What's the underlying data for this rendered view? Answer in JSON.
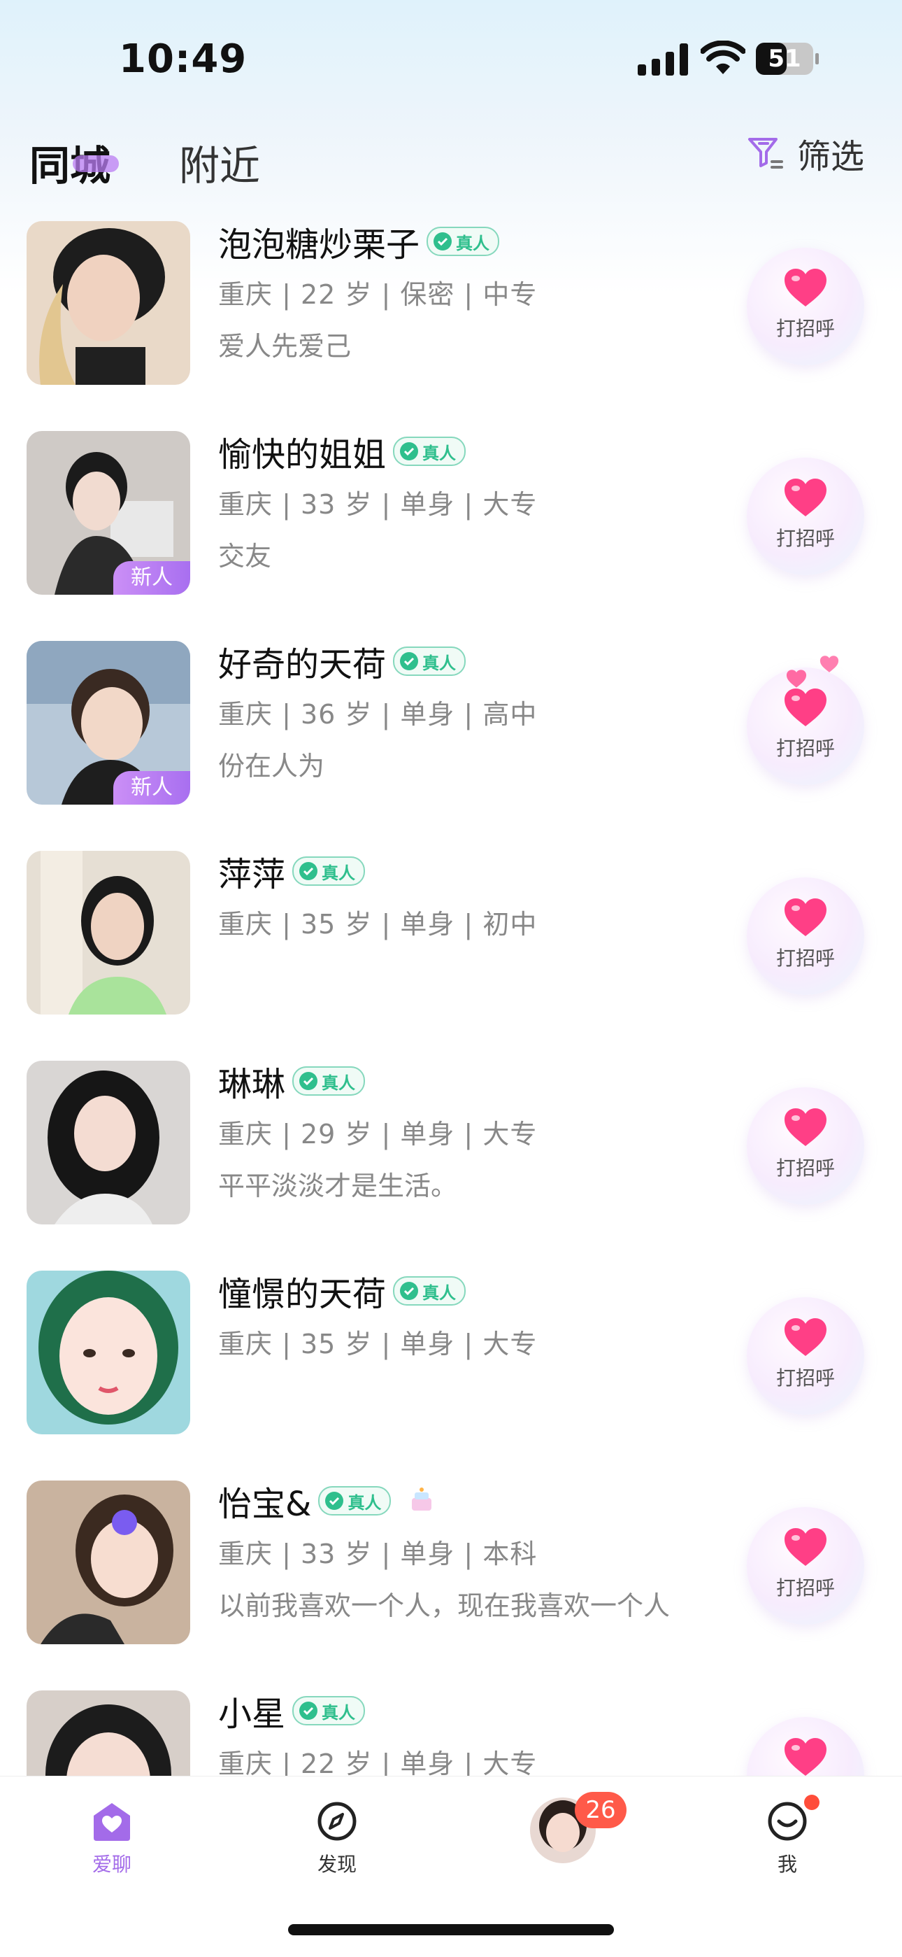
{
  "status_bar": {
    "time": "10:49",
    "battery": "51"
  },
  "header": {
    "tabs": [
      {
        "label": "同城",
        "active": true
      },
      {
        "label": "附近",
        "active": false
      }
    ],
    "filter_label": "筛选"
  },
  "verified_label": "真人",
  "greet_label": "打招呼",
  "new_tag": "新人",
  "users": [
    {
      "name": "泡泡糖炒栗子",
      "info": "重庆 | 22 岁 | 保密 | 中专",
      "signature": "爱人先爱己",
      "new": false
    },
    {
      "name": "愉快的姐姐",
      "info": "重庆 | 33 岁 | 单身 | 大专",
      "signature": "交友",
      "new": true
    },
    {
      "name": "好奇的天荷",
      "info": "重庆 | 36 岁 | 单身 | 高中",
      "signature": "份在人为",
      "new": true
    },
    {
      "name": "萍萍",
      "info": "重庆 | 35 岁 | 单身 | 初中",
      "signature": "",
      "new": false
    },
    {
      "name": "琳琳",
      "info": "重庆 | 29 岁 | 单身 | 大专",
      "signature": "平平淡淡才是生活。",
      "new": false
    },
    {
      "name": "憧憬的天荷",
      "info": "重庆 | 35 岁 | 单身 | 大专",
      "signature": "",
      "new": false
    },
    {
      "name": "怡宝&",
      "info": "重庆 | 33 岁 | 单身 | 本科",
      "signature": "以前我喜欢一个人，现在我喜欢一个人",
      "new": false
    },
    {
      "name": "小星",
      "info": "重庆 | 22 岁 | 单身 | 大专",
      "signature": "",
      "new": false
    }
  ],
  "nav": {
    "items": [
      {
        "label": "爱聊",
        "icon": "home-heart-icon",
        "active": true
      },
      {
        "label": "发现",
        "icon": "compass-icon",
        "active": false
      },
      {
        "label": "",
        "icon": "avatar",
        "active": false
      },
      {
        "label": "我",
        "icon": "smile-icon",
        "active": false
      }
    ],
    "message_badge": "26"
  },
  "colors": {
    "accent": "#a36be9",
    "verified": "#2fbf8d",
    "heart": "#ff3f86",
    "badge": "#ff5a49"
  }
}
